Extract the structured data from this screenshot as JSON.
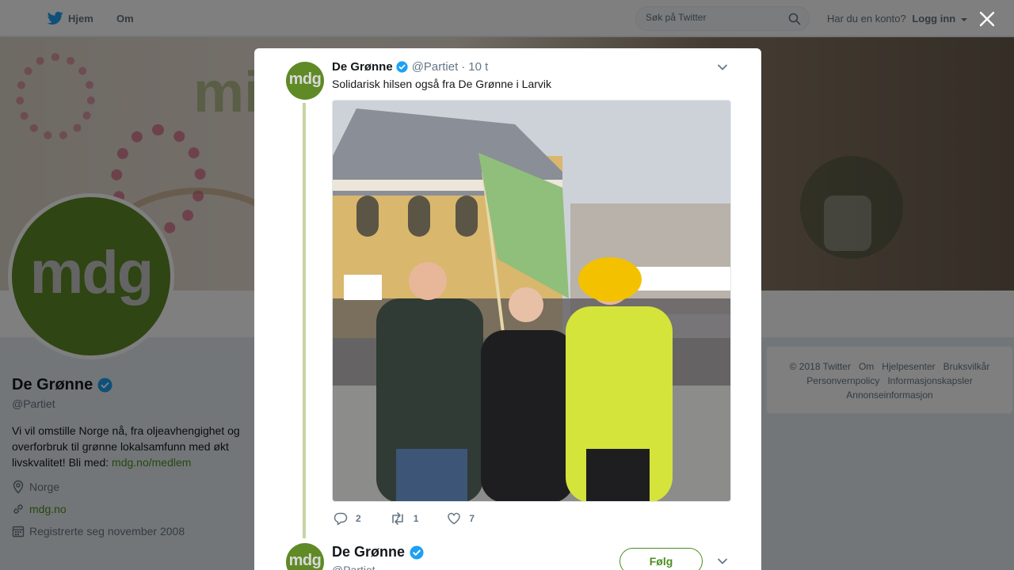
{
  "nav": {
    "home_label": "Hjem",
    "about_label": "Om",
    "search_placeholder": "Søk på Twitter",
    "account_prompt": "Har du en konto?",
    "login_label": "Logg inn"
  },
  "profile": {
    "avatar_text": "mdg",
    "banner_text": "mil de",
    "name": "De Grønne",
    "handle": "@Partiet",
    "bio_text": "Vi vil omstille Norge nå, fra oljeavhengighet og overforbruk til grønne lokalsamfunn med økt livskvalitet! Bli med: ",
    "bio_link": "mdg.no/medlem",
    "location": "Norge",
    "website": "mdg.no",
    "joined": "Registrerte seg november 2008"
  },
  "footer": {
    "links": [
      "© 2018 Twitter",
      "Om",
      "Hjelpesenter",
      "Bruksvilkår",
      "Personvernpolicy",
      "Informasjonskapsler",
      "Annonseinformasjon"
    ]
  },
  "tweet": {
    "avatar_text": "mdg",
    "author_name": "De Grønne",
    "author_handle": "@Partiet",
    "separator": "·",
    "time": "10 t",
    "text": "Solidarisk hilsen også fra De Grønne i Larvik",
    "replies": "2",
    "retweets": "1",
    "likes": "7"
  },
  "tweet2": {
    "avatar_text": "mdg",
    "author_name": "De Grønne",
    "author_handle": "@Partiet",
    "follow_label": "Følg"
  },
  "colors": {
    "brand_green": "#5f8a26",
    "link_green": "#4a8f1f",
    "verified_blue": "#1da1f2"
  }
}
